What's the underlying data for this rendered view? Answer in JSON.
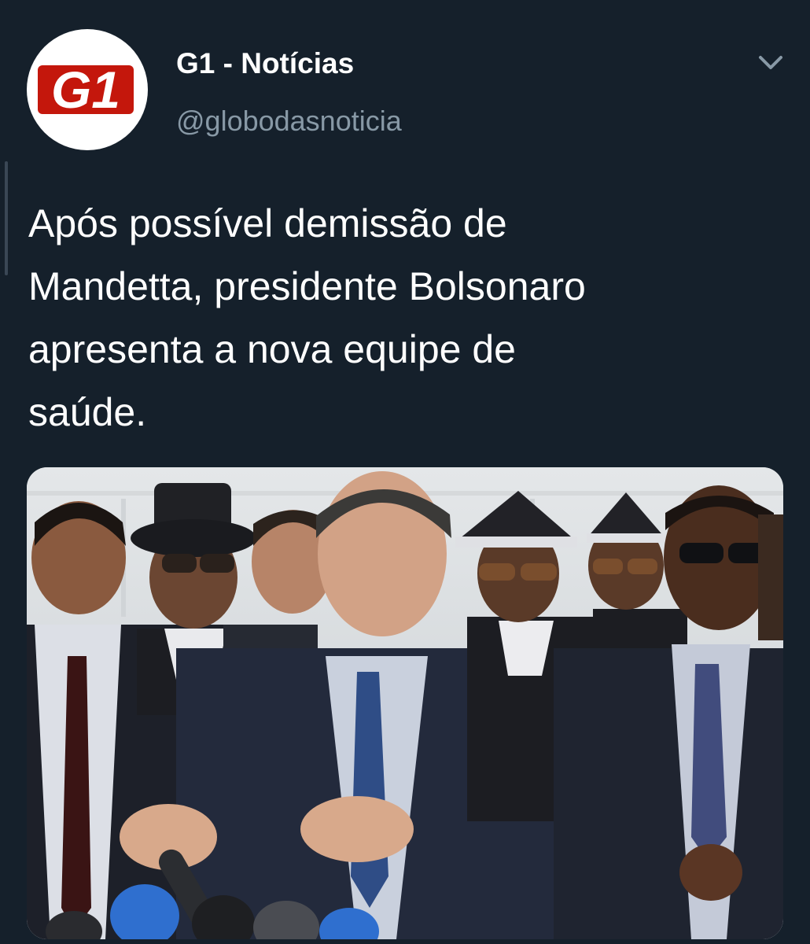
{
  "tweet": {
    "display_name": "G1 - Notícias",
    "handle": "@globodasnoticia",
    "avatar_icon": "g1-logo",
    "avatar_text": "G1",
    "menu_icon": "chevron-down-icon",
    "text_lines": [
      "Após possível demissão de",
      "Mandetta, presidente Bolsonaro",
      "apresenta a nova equipe de",
      "saúde."
    ]
  },
  "colors": {
    "background": "#15202b",
    "name_text": "#ffffff",
    "handle_text": "#8899a6",
    "g1_red": "#c4170c"
  }
}
